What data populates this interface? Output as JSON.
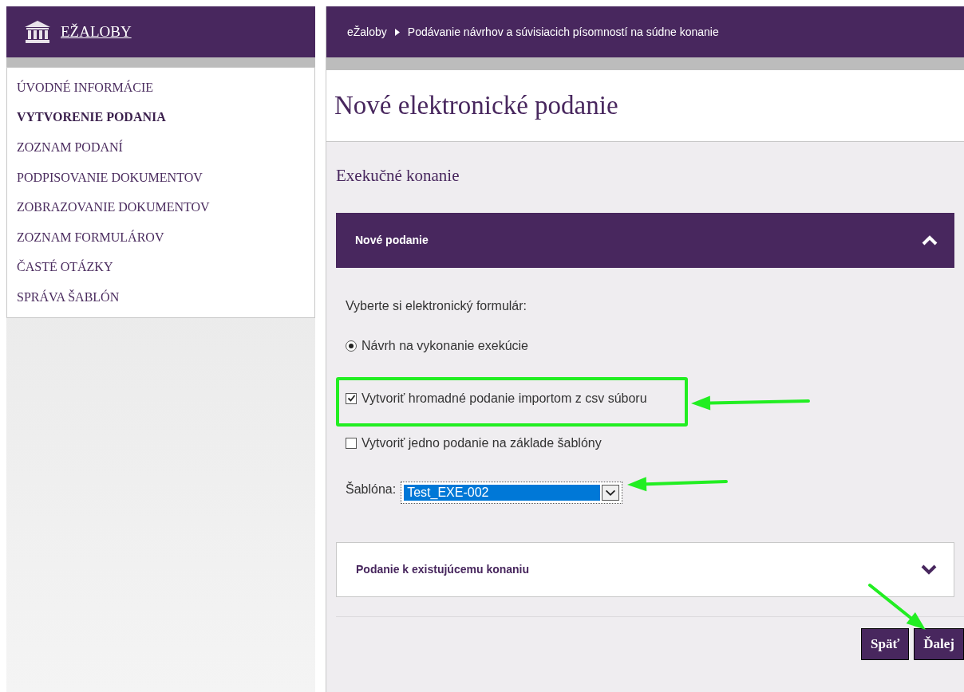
{
  "brand": {
    "title": "EŽALOBY"
  },
  "menu": [
    {
      "label": "ÚVODNÉ INFORMÁCIE",
      "selected": false
    },
    {
      "label": "VYTVORENIE PODANIA",
      "selected": true
    },
    {
      "label": "ZOZNAM PODANÍ",
      "selected": false
    },
    {
      "label": "PODPISOVANIE DOKUMENTOV",
      "selected": false
    },
    {
      "label": "ZOBRAZOVANIE DOKUMENTOV",
      "selected": false
    },
    {
      "label": "ZOZNAM FORMULÁROV",
      "selected": false
    },
    {
      "label": "ČASTÉ OTÁZKY",
      "selected": false
    },
    {
      "label": "SPRÁVA ŠABLÓN",
      "selected": false
    }
  ],
  "breadcrumb": [
    "eŽaloby",
    "Podávanie návrhov a súvisiacich písomností na súdne konanie"
  ],
  "page_title": "Nové elektronické podanie",
  "section_title": "Exekučné konanie",
  "panels": [
    {
      "title": "Nové podanie",
      "expanded": true,
      "prompt": "Vyberte si elektronický formulár:",
      "options": [
        {
          "kind": "radio",
          "label": "Návrh na vykonanie exekúcie",
          "checked": true
        },
        {
          "kind": "checkbox",
          "label": "Vytvoriť hromadné podanie importom z csv súboru",
          "checked": true
        },
        {
          "kind": "checkbox",
          "label": "Vytvoriť jedno podanie na základe šablóny",
          "checked": false
        }
      ],
      "template": {
        "label": "Šablóna:",
        "value": "Test_EXE-002"
      }
    },
    {
      "title": "Podanie k existujúcemu konaniu",
      "expanded": false
    }
  ],
  "buttons": [
    "Späť",
    "Ďalej"
  ]
}
